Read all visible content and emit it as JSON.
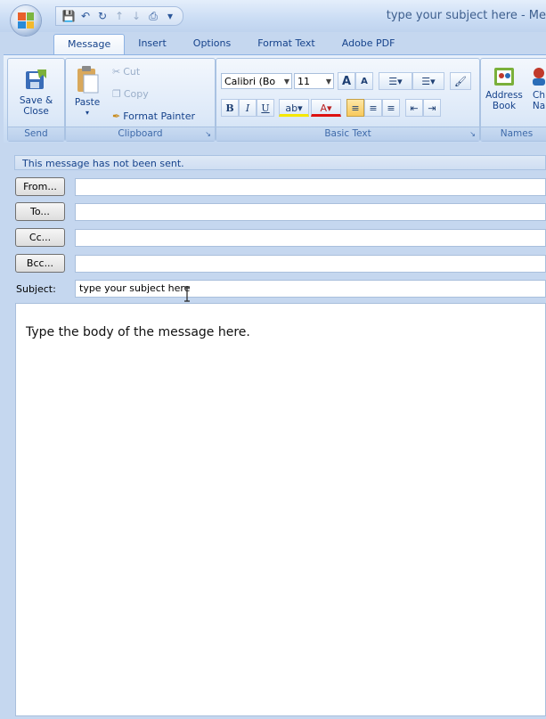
{
  "window": {
    "title": "type your subject here - Me"
  },
  "tabs": [
    "Message",
    "Insert",
    "Options",
    "Format Text",
    "Adobe PDF"
  ],
  "ribbon": {
    "send": {
      "label": "Send",
      "save_close": "Save &\nClose"
    },
    "clipboard": {
      "label": "Clipboard",
      "paste": "Paste",
      "cut": "Cut",
      "copy": "Copy",
      "format_painter": "Format Painter"
    },
    "basic_text": {
      "label": "Basic Text",
      "font": "Calibri (Bo",
      "size": "11"
    },
    "names": {
      "label": "Names",
      "address_book": "Address\nBook",
      "check_names": "Ch\nNa"
    }
  },
  "info_bar": "This message has not been sent.",
  "header": {
    "from_button": "From...",
    "to_button": "To...",
    "cc_button": "Cc...",
    "bcc_button": "Bcc...",
    "subject_label": "Subject:",
    "subject_value": "type your subject here"
  },
  "body": {
    "text": "Type the body of the message here."
  },
  "colors": {
    "accent": "#15428b",
    "ribbon_bg": "#d9e7f7",
    "highlight": "#f8c95c"
  }
}
